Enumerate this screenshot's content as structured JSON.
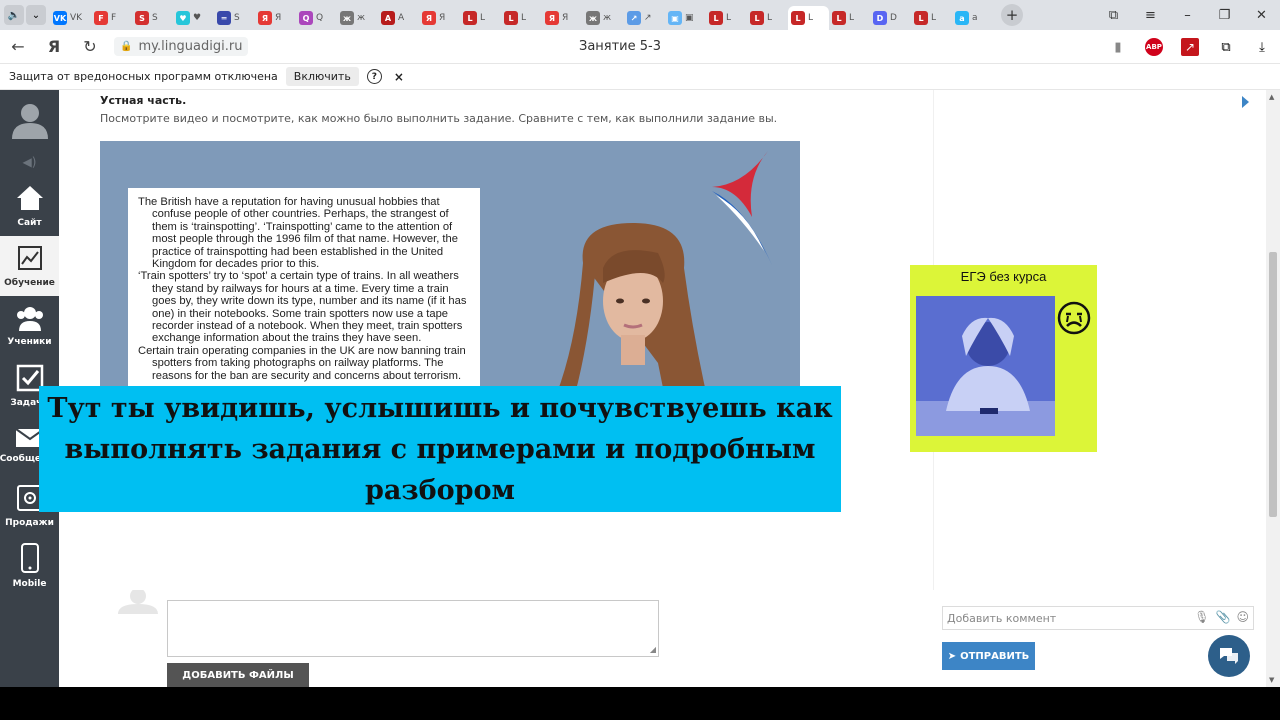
{
  "browser": {
    "tabs": [
      {
        "fav": "VK",
        "color": "#0077ff",
        "label": "VK"
      },
      {
        "fav": "F",
        "color": "#e53935",
        "label": "F"
      },
      {
        "fav": "S",
        "color": "#d32f2f",
        "label": "S"
      },
      {
        "fav": "♥",
        "color": "#26c6da",
        "label": "♥"
      },
      {
        "fav": "═",
        "color": "#3949ab",
        "label": "S"
      },
      {
        "fav": "Я",
        "color": "#e53935",
        "label": "Я"
      },
      {
        "fav": "Q",
        "color": "#ab47bc",
        "label": "Q"
      },
      {
        "fav": "ж",
        "color": "#777777",
        "label": "ж"
      },
      {
        "fav": "A",
        "color": "#b71c1c",
        "label": "A"
      },
      {
        "fav": "Я",
        "color": "#e53935",
        "label": "Я"
      },
      {
        "fav": "L",
        "color": "#c62828",
        "label": "L"
      },
      {
        "fav": "L",
        "color": "#c62828",
        "label": "L"
      },
      {
        "fav": "Я",
        "color": "#e53935",
        "label": "Я"
      },
      {
        "fav": "ж",
        "color": "#777777",
        "label": "ж"
      },
      {
        "fav": "↗",
        "color": "#5c9be6",
        "label": "↗"
      },
      {
        "fav": "▣",
        "color": "#64b5f6",
        "label": "▣"
      },
      {
        "fav": "L",
        "color": "#c62828",
        "label": "L"
      },
      {
        "fav": "L",
        "color": "#c62828",
        "label": "L"
      },
      {
        "fav": "L",
        "color": "#c62828",
        "label": "L",
        "active": true
      },
      {
        "fav": "L",
        "color": "#c62828",
        "label": "L"
      },
      {
        "fav": "D",
        "color": "#5865f2",
        "label": "D"
      },
      {
        "fav": "L",
        "color": "#c62828",
        "label": "L"
      },
      {
        "fav": "a",
        "color": "#29b6f6",
        "label": "a"
      }
    ],
    "url": "my.linguadigi.ru",
    "page_title": "Занятие 5-3",
    "abp_label": "ABP"
  },
  "notice": {
    "text": "Защита от вредоносных программ отключена",
    "enable_label": "Включить",
    "help_label": "?",
    "close_label": "×"
  },
  "sidebar": {
    "items": [
      {
        "id": "site",
        "label": "Сайт",
        "icon": "home-icon"
      },
      {
        "id": "learning",
        "label": "Обучение",
        "icon": "chart-icon",
        "active": true
      },
      {
        "id": "students",
        "label": "Ученики",
        "icon": "users-icon"
      },
      {
        "id": "tasks",
        "label": "Задачи",
        "icon": "checkbox-icon"
      },
      {
        "id": "messages",
        "label": "Сообщения",
        "icon": "mail-icon"
      },
      {
        "id": "sales",
        "label": "Продажи",
        "icon": "sales-icon"
      },
      {
        "id": "mobile",
        "label": "Mobile",
        "icon": "phone-icon"
      }
    ]
  },
  "content": {
    "oral_title": "Устная часть.",
    "oral_desc": "Посмотрите видео и посмотрите, как можно было выполнить задание. Сравните с тем, как выполнили задание вы.",
    "reading_text": [
      "The British have a reputation for having unusual hobbies that confuse people of other countries. Perhaps, the strangest of them is ‘trainspotting’. ‘Trainspotting’ came to the attention of most people through the 1996 film of that name. However, the practice of trainspotting had been established in the United Kingdom for decades prior to this.",
      "‘Train spotters’ try to ‘spot’ a certain type of trains. In all weathers they stand by railways for hours at a time. Every time a train goes by, they write down its type, number and its name (if it has one) in their notebooks. Some train spotters now use a tape recorder instead of a notebook. When they meet, train spotters exchange information about the trains they have seen.",
      "Certain train operating companies in the UK are now banning train spotters from taking photographs on railway platforms. The reasons for the ban are security and concerns about terrorism."
    ],
    "caption": "Тут ты увидишь, услышишь и почувствуешь как выполнять задания с примерами и подробным разбором",
    "add_files_label": "ДОБАВИТЬ ФАЙЛЫ"
  },
  "ad": {
    "title": "ЕГЭ без курса",
    "bg_color": "#dcf538"
  },
  "comments": {
    "placeholder": "Добавить коммент",
    "send_label": "ОТПРАВИТЬ"
  },
  "colors": {
    "sidebar": "#3a4149",
    "caption": "#00bff2",
    "accent": "#3d85c6",
    "video_bg": "#7f9ab9"
  }
}
